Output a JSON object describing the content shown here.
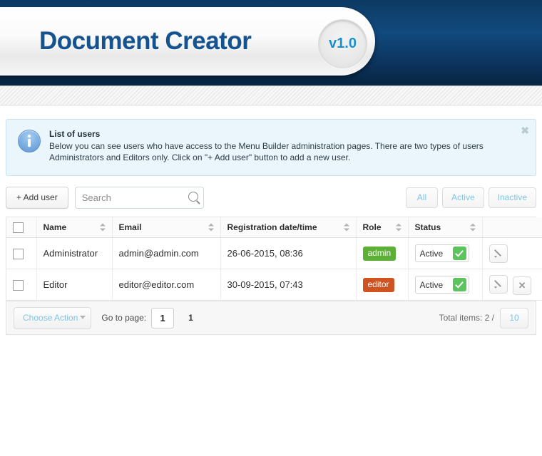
{
  "header": {
    "title": "Document Creator",
    "version": "v1.0"
  },
  "notice": {
    "icon": "info-icon",
    "title": "List of users",
    "body": "Below you can see users who have access to the Menu Builder administration pages. There are two types of users Administrators and Editors only. Click on \"+ Add user\" button to add a new user.",
    "close_label": "✖"
  },
  "toolbar": {
    "add_user_label": "+ Add user",
    "search_placeholder": "Search",
    "search_value": "",
    "filters": [
      {
        "label": "All"
      },
      {
        "label": "Active"
      },
      {
        "label": "Inactive"
      }
    ]
  },
  "table": {
    "columns": [
      {
        "key": "check",
        "label": ""
      },
      {
        "key": "name",
        "label": "Name"
      },
      {
        "key": "email",
        "label": "Email"
      },
      {
        "key": "date",
        "label": "Registration date/time"
      },
      {
        "key": "role",
        "label": "Role"
      },
      {
        "key": "status",
        "label": "Status"
      },
      {
        "key": "actions",
        "label": ""
      }
    ],
    "rows": [
      {
        "name": "Administrator",
        "email": "admin@admin.com",
        "date": "26-06-2015, 08:36",
        "role": "admin",
        "role_color": "#5cb036",
        "status": "Active",
        "actions": [
          "edit"
        ]
      },
      {
        "name": "Editor",
        "email": "editor@editor.com",
        "date": "30-09-2015, 07:43",
        "role": "editor",
        "role_color": "#cf5221",
        "status": "Active",
        "actions": [
          "edit",
          "delete"
        ]
      }
    ]
  },
  "pager": {
    "choose_action_label": "Choose Action",
    "goto_label": "Go to page:",
    "goto_value": "1",
    "current_page": "1",
    "total_label": "Total items: 2 /",
    "per_page": "10"
  }
}
